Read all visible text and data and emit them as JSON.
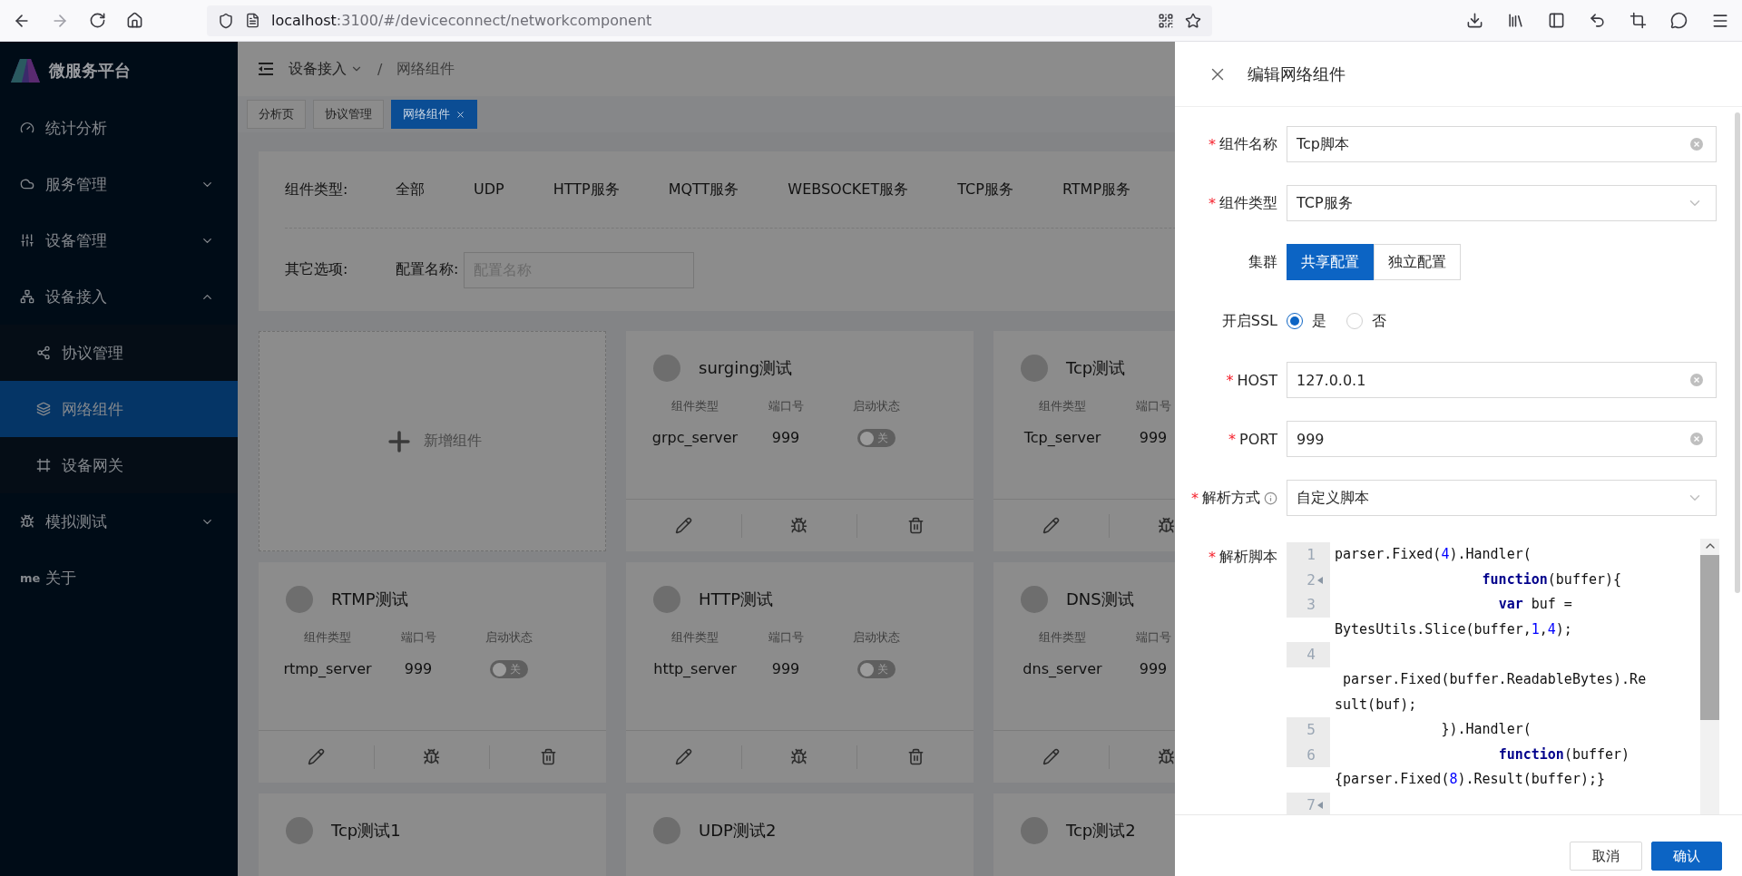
{
  "browser": {
    "url_host": "localhost",
    "url_path": ":3100/#/deviceconnect/networkcomponent"
  },
  "sidebar": {
    "title": "微服务平台",
    "items": [
      {
        "label": "统计分析",
        "selected": false
      },
      {
        "label": "服务管理",
        "selected": false,
        "expanded": false
      },
      {
        "label": "设备管理",
        "selected": false,
        "expanded": false
      },
      {
        "label": "设备接入",
        "selected": false,
        "expanded": true,
        "children": [
          {
            "label": "协议管理",
            "selected": false
          },
          {
            "label": "网络组件",
            "selected": true
          },
          {
            "label": "设备网关",
            "selected": false
          }
        ]
      },
      {
        "label": "模拟测试",
        "selected": false,
        "expanded": false
      },
      {
        "label": "关于",
        "selected": false,
        "icon_text": "me"
      }
    ]
  },
  "breadcrumb": {
    "separator": "/",
    "items": [
      {
        "label": "设备接入",
        "dropdown": true
      },
      {
        "label": "网络组件",
        "dropdown": false
      }
    ]
  },
  "tabs": [
    {
      "label": "分析页",
      "selected": false,
      "closable": false
    },
    {
      "label": "协议管理",
      "selected": false,
      "closable": false
    },
    {
      "label": "网络组件",
      "selected": true,
      "closable": true
    }
  ],
  "filter": {
    "type_label": "组件类型:",
    "types": [
      "全部",
      "UDP",
      "HTTP服务",
      "MQTT服务",
      "WEBSOCKET服务",
      "TCP服务",
      "RTMP服务"
    ],
    "other_label": "其它选项:",
    "name_label": "配置名称:",
    "name_placeholder": "配置名称"
  },
  "cards": [
    {
      "kind": "add",
      "label": "新增组件"
    },
    {
      "kind": "component",
      "title": "surging测试",
      "fields": [
        {
          "label": "组件类型",
          "value": "grpc_server"
        },
        {
          "label": "端口号",
          "value": "999"
        }
      ],
      "status": {
        "label": "启动状态",
        "on": false,
        "text": "关"
      },
      "actions": [
        {
          "kind": "edit"
        },
        {
          "kind": "debug"
        },
        {
          "kind": "delete"
        }
      ]
    },
    {
      "kind": "component",
      "title": "Tcp测试",
      "fields": [
        {
          "label": "组件类型",
          "value": "Tcp_server"
        },
        {
          "label": "端口号",
          "value": "999"
        }
      ],
      "actions": [
        {
          "kind": "edit"
        },
        {
          "kind": "debug"
        }
      ]
    },
    {
      "kind": "component",
      "title": "RTMP测试",
      "fields": [
        {
          "label": "组件类型",
          "value": "rtmp_server"
        },
        {
          "label": "端口号",
          "value": "999"
        }
      ],
      "status": {
        "label": "启动状态",
        "on": false,
        "text": "关"
      },
      "actions": [
        {
          "kind": "edit"
        },
        {
          "kind": "debug"
        },
        {
          "kind": "delete"
        }
      ]
    },
    {
      "kind": "component",
      "title": "HTTP测试",
      "fields": [
        {
          "label": "组件类型",
          "value": "http_server"
        },
        {
          "label": "端口号",
          "value": "999"
        }
      ],
      "status": {
        "label": "启动状态",
        "on": false,
        "text": "关"
      },
      "actions": [
        {
          "kind": "edit"
        },
        {
          "kind": "debug"
        },
        {
          "kind": "delete"
        }
      ]
    },
    {
      "kind": "component",
      "title": "DNS测试",
      "fields": [
        {
          "label": "组件类型",
          "value": "dns_server"
        },
        {
          "label": "端口号",
          "value": "999"
        }
      ],
      "actions": [
        {
          "kind": "edit"
        },
        {
          "kind": "debug"
        }
      ]
    },
    {
      "kind": "component",
      "title": "Tcp测试1"
    },
    {
      "kind": "component",
      "title": "UDP测试2"
    },
    {
      "kind": "component",
      "title": "Tcp测试2"
    }
  ],
  "drawer": {
    "title": "编辑网络组件",
    "fields": [
      {
        "kind": "input",
        "label": "组件名称",
        "required_mark": "*",
        "value": "Tcp脚本"
      },
      {
        "kind": "select",
        "label": "组件类型",
        "required_mark": "*",
        "value": "TCP服务"
      },
      {
        "kind": "button_group",
        "label": "集群",
        "options": [
          {
            "label": "共享配置",
            "selected": true
          },
          {
            "label": "独立配置",
            "selected": false
          }
        ]
      },
      {
        "kind": "radio",
        "label": "开启SSL",
        "options": [
          {
            "label": "是",
            "selected": true
          },
          {
            "label": "否",
            "selected": false
          }
        ]
      },
      {
        "kind": "input",
        "label": "HOST",
        "required_mark": "*",
        "value": "127.0.0.1"
      },
      {
        "kind": "input",
        "label": "PORT",
        "required_mark": "*",
        "value": "999"
      },
      {
        "kind": "select",
        "label": "解析方式",
        "required_mark": "*",
        "info": true,
        "value": "自定义脚本"
      },
      {
        "kind": "code",
        "label": "解析脚本",
        "required_mark": "*",
        "lines": [
          {
            "number": "1",
            "fold": false,
            "rows": [
              "parser.Fixed(*4*).Handler("
            ]
          },
          {
            "number": "2",
            "fold": true,
            "rows": [
              "                  **function**(buffer){"
            ]
          },
          {
            "number": "3",
            "fold": false,
            "rows": [
              "                    **var** buf =",
              "BytesUtils.Slice(buffer,*1*,*4*);"
            ]
          },
          {
            "number": "4",
            "fold": false,
            "leading_blank_row": true,
            "rows": [
              " parser.Fixed(buffer.ReadableBytes).Re",
              "sult(buf);"
            ]
          },
          {
            "number": "5",
            "fold": false,
            "rows": [
              "             }).Handler("
            ]
          },
          {
            "number": "6",
            "fold": false,
            "rows": [
              "                    **function**(buffer)",
              "{parser.Fixed(*8*).Result(buffer);}"
            ]
          },
          {
            "number": "7",
            "fold": true
          }
        ]
      }
    ],
    "buttons": [
      {
        "label": "取消",
        "kind": "default"
      },
      {
        "label": "确认",
        "kind": "primary"
      }
    ]
  }
}
